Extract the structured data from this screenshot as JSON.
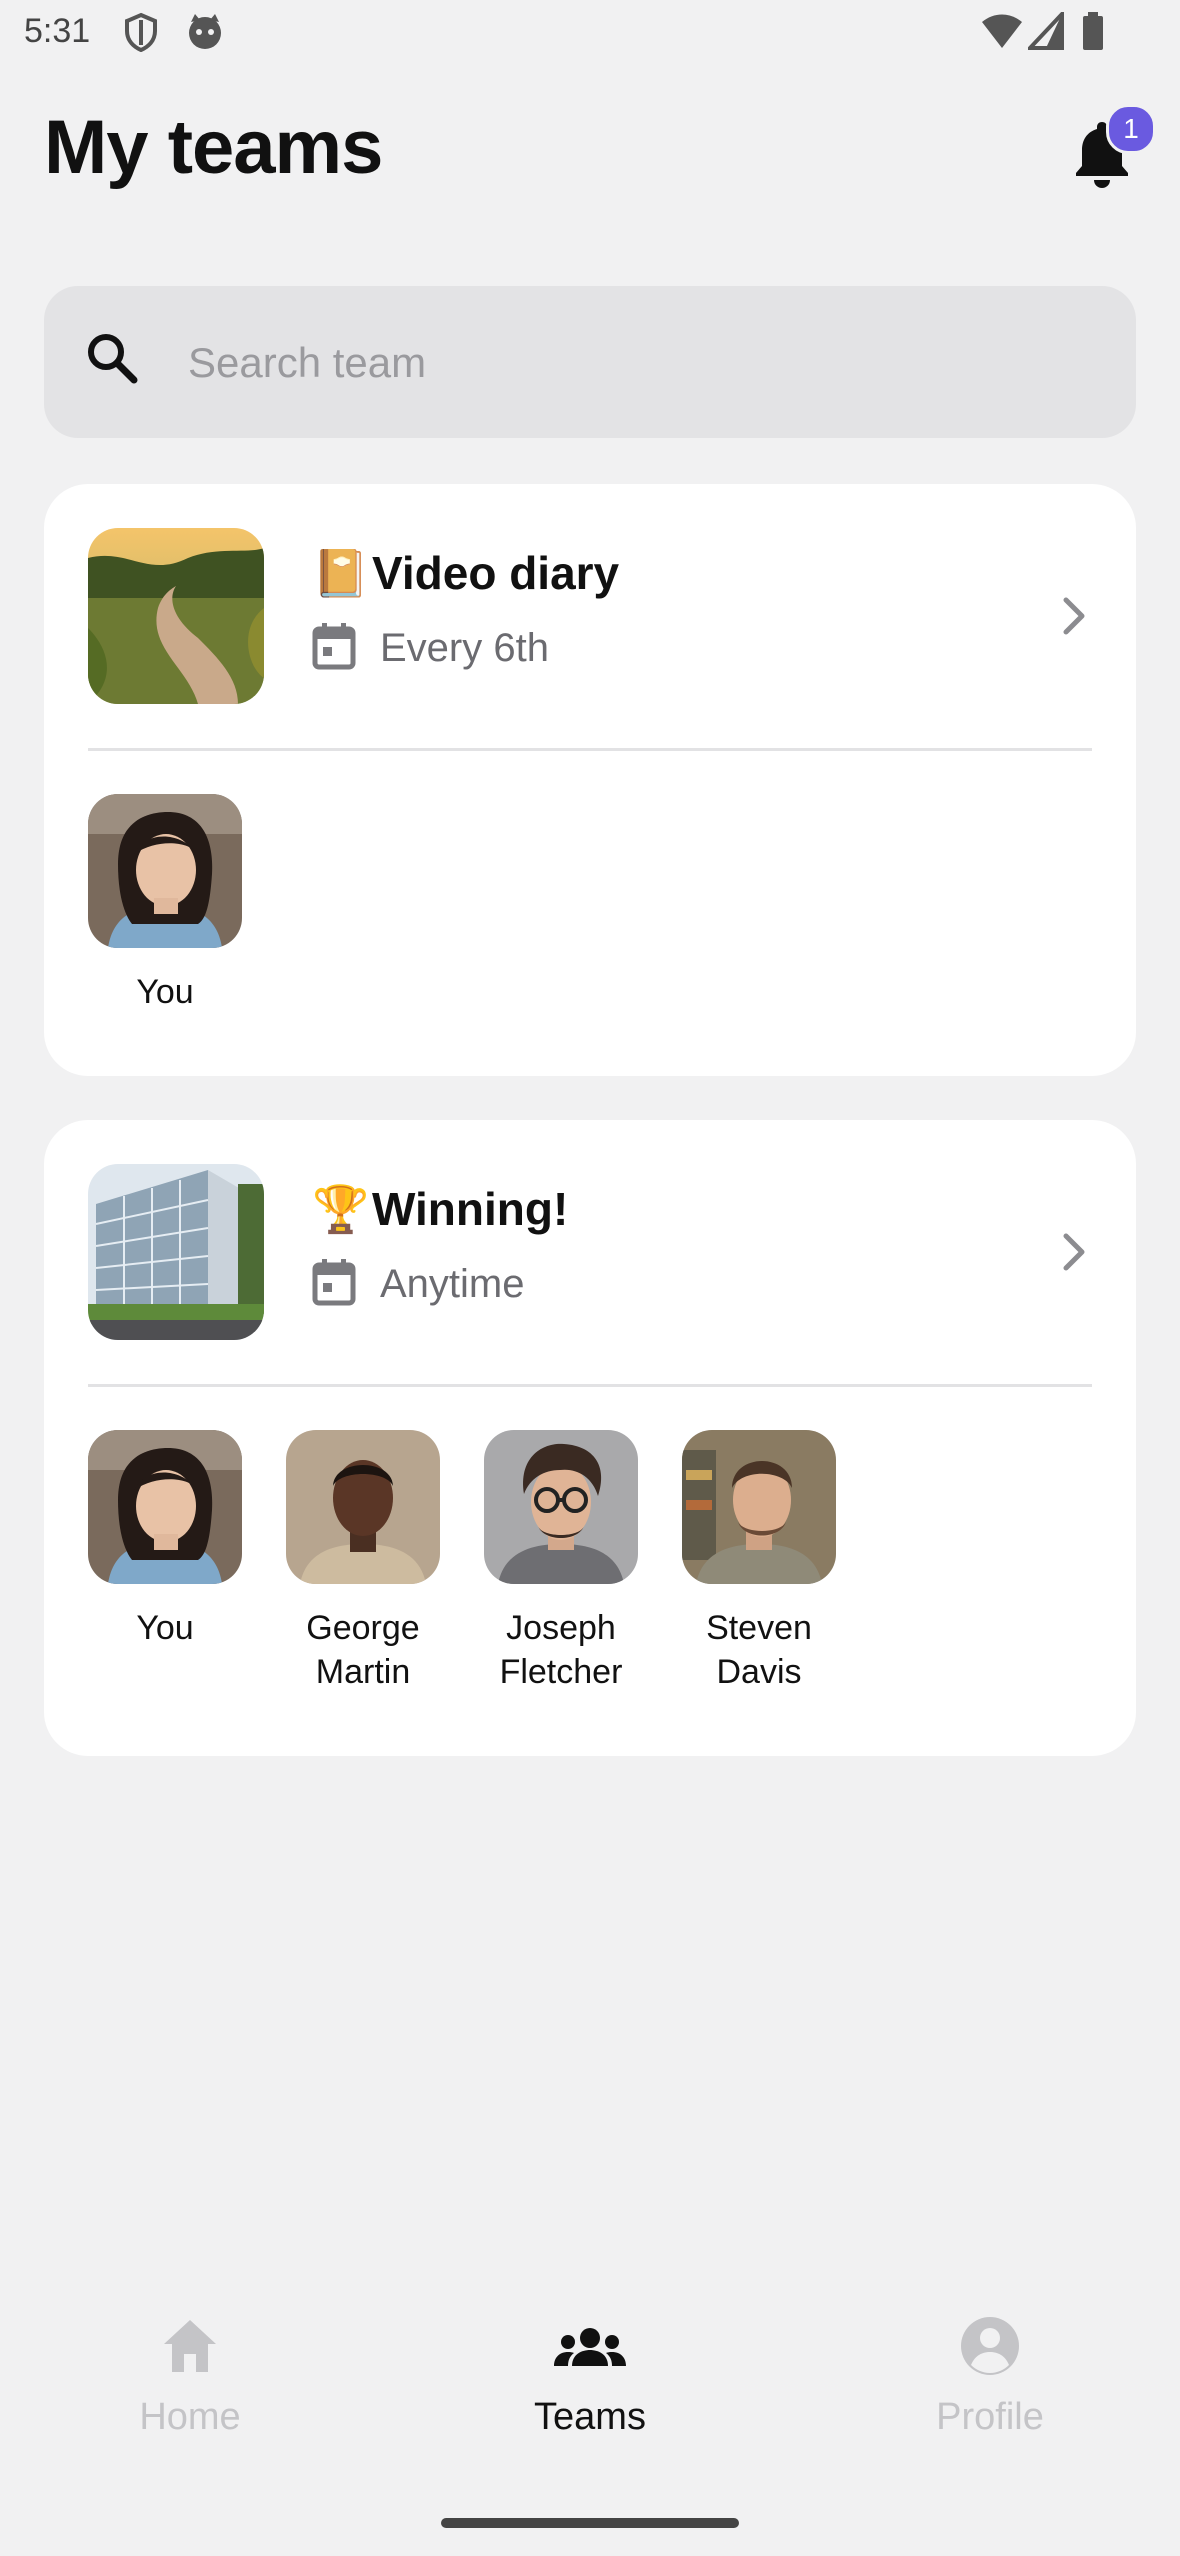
{
  "status_bar": {
    "time": "5:31"
  },
  "header": {
    "title": "My teams",
    "notification_count": "1"
  },
  "search": {
    "placeholder": "Search team",
    "value": ""
  },
  "teams": [
    {
      "emoji": "📔",
      "name": "Video diary",
      "schedule": "Every 6th",
      "members": [
        {
          "name": "You"
        }
      ]
    },
    {
      "emoji": "🏆",
      "name": "Winning!",
      "schedule": "Anytime",
      "members": [
        {
          "name": "You"
        },
        {
          "name": "George Martin"
        },
        {
          "name": "Joseph Fletcher"
        },
        {
          "name": "Steven Davis"
        }
      ]
    }
  ],
  "nav": {
    "items": [
      {
        "label": "Home",
        "icon": "home-icon",
        "active": false
      },
      {
        "label": "Teams",
        "icon": "teams-icon",
        "active": true
      },
      {
        "label": "Profile",
        "icon": "profile-icon",
        "active": false
      }
    ]
  },
  "colors": {
    "accent": "#6a5ae0",
    "background": "#f1f1f2",
    "card": "#ffffff"
  }
}
